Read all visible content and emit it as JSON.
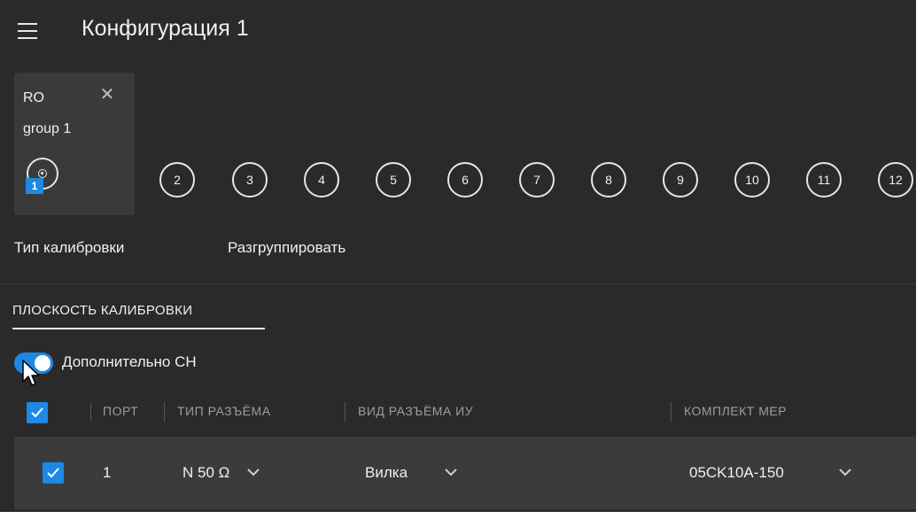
{
  "header": {
    "title": "Конфигурация 1"
  },
  "group": {
    "name": "RO",
    "label": "group 1",
    "port_badge": "1"
  },
  "ports": [
    "2",
    "3",
    "4",
    "5",
    "6",
    "7",
    "8",
    "9",
    "10",
    "11",
    "12"
  ],
  "actions": {
    "calibration_type": "Тип калибровки",
    "ungroup": "Разгруппировать"
  },
  "tab": {
    "label": "ПЛОСКОСТЬ КАЛИБРОВКИ"
  },
  "toggle": {
    "label": "Дополнительно CH",
    "on": true
  },
  "table": {
    "columns": [
      "ПОРТ",
      "ТИП РАЗЪЁМА",
      "ВИД РАЗЪЁМА ИУ",
      "КОМПЛЕКТ МЕР"
    ],
    "rows": [
      {
        "checked": true,
        "port": "1",
        "connector_type": "N 50 Ω",
        "dut_connector": "Вилка",
        "cal_kit": "05CK10A-150"
      }
    ]
  },
  "colors": {
    "accent": "#1e88e5",
    "background": "#2a2a2a",
    "panel": "#3a3a3a"
  }
}
